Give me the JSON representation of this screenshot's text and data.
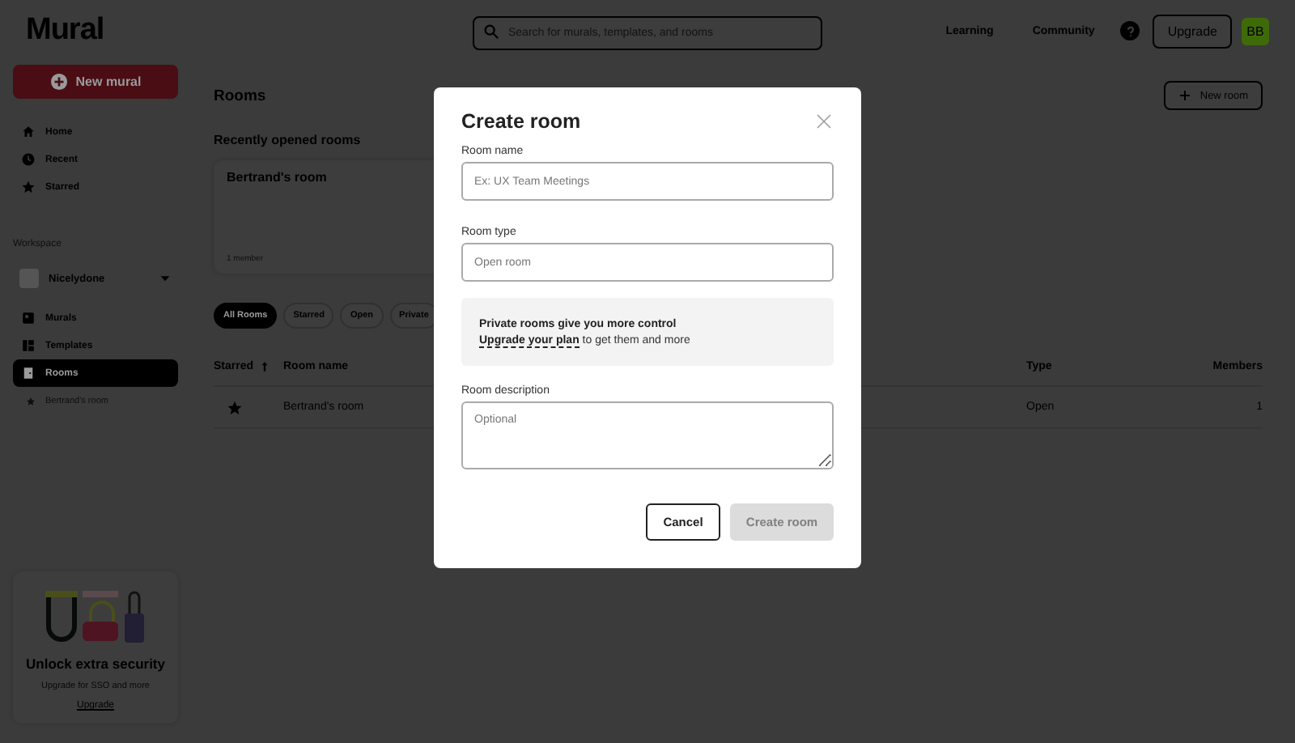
{
  "logo": "Mural",
  "sidebar": {
    "new_button": "New mural",
    "nav": [
      {
        "label": "Home",
        "selected": false
      },
      {
        "label": "Recent",
        "selected": false
      },
      {
        "label": "Starred",
        "selected": false
      }
    ],
    "workspace_label": "Workspace",
    "workspace": "Nicelydone",
    "workspace_nav": [
      {
        "label": "Murals",
        "selected": false
      },
      {
        "label": "Templates",
        "selected": false
      },
      {
        "label": "Rooms",
        "selected": true
      }
    ],
    "starred_rooms": [
      "Bertrand's room"
    ],
    "promo": {
      "title": "Unlock extra security",
      "text": "Upgrade for SSO and more",
      "link": "Upgrade"
    }
  },
  "header": {
    "search_placeholder": "Search for murals, templates, and rooms",
    "links": [
      "Learning",
      "Community"
    ],
    "upgrade": "Upgrade",
    "avatar": "BB"
  },
  "main": {
    "title": "Rooms",
    "new_room": "New room",
    "recent_title": "Recently opened rooms",
    "recent_cards": [
      {
        "name": "Bertrand's room",
        "members": "1 member"
      }
    ],
    "filters": [
      {
        "label": "All Rooms",
        "selected": true
      },
      {
        "label": "Starred",
        "selected": false
      },
      {
        "label": "Open",
        "selected": false
      },
      {
        "label": "Private",
        "selected": false
      }
    ],
    "table": {
      "columns": [
        "Starred",
        "Room name",
        "Type",
        "Members"
      ],
      "rows": [
        {
          "starred": true,
          "name": "Bertrand's room",
          "type": "Open",
          "members": "1"
        }
      ]
    }
  },
  "dialog": {
    "title": "Create room",
    "fields": [
      {
        "kind": "input",
        "label": "Room name",
        "placeholder": "Ex: UX Team Meetings"
      },
      {
        "kind": "input",
        "label": "Room type",
        "placeholder": "Open room"
      },
      {
        "kind": "info",
        "title": "Private rooms give you more control",
        "link": "Upgrade your plan",
        "text": "to get them and more"
      },
      {
        "kind": "textarea",
        "label": "Room description",
        "placeholder": "Optional"
      }
    ],
    "cancel": "Cancel",
    "submit": {
      "label": "Create room",
      "disabled": true
    }
  }
}
